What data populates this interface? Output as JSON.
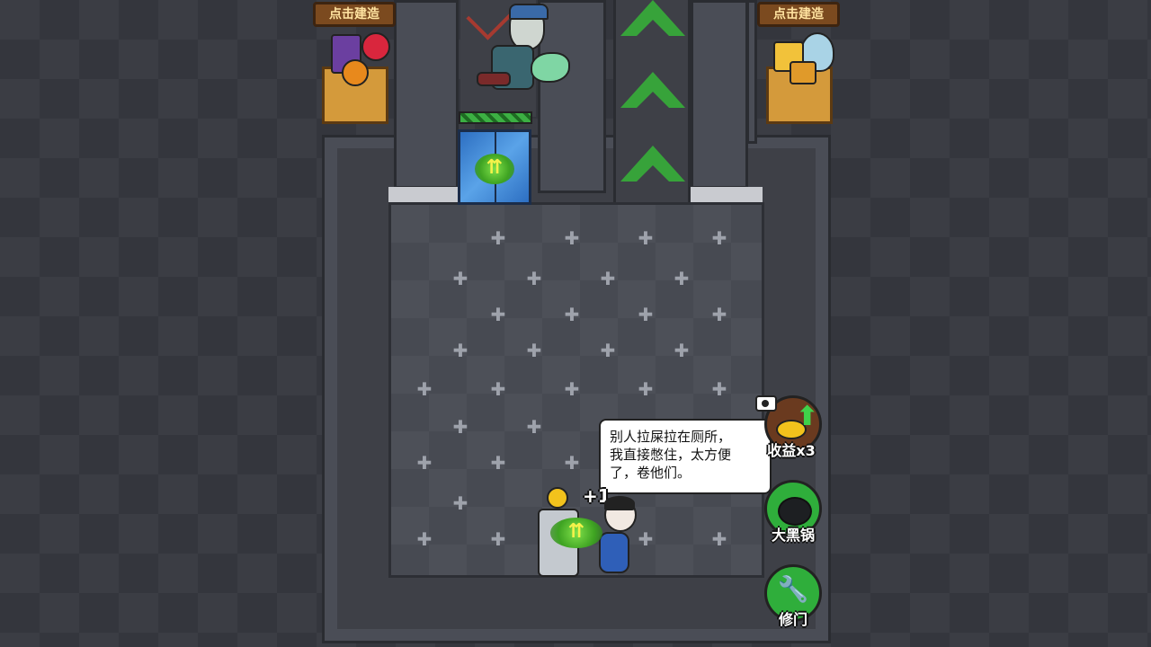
{
  "build_signs": {
    "left_label": "点击建造",
    "right_label": "点击建造"
  },
  "speech_bubble": {
    "text": "别人拉屎拉在厕所，\n我直接憋住，太方便\n了，卷他们。"
  },
  "coin_popup": {
    "text": "+1"
  },
  "side_buttons": {
    "income": {
      "label": "收益x3",
      "icon": "video-icon"
    },
    "pot": {
      "label": "大黑锅"
    },
    "repair": {
      "label": "修门",
      "icon": "wrench-icon"
    }
  },
  "colors": {
    "arrow_green": "#37a33a",
    "button_green": "#2fae3b",
    "sign_brown": "#7b4a1f"
  }
}
